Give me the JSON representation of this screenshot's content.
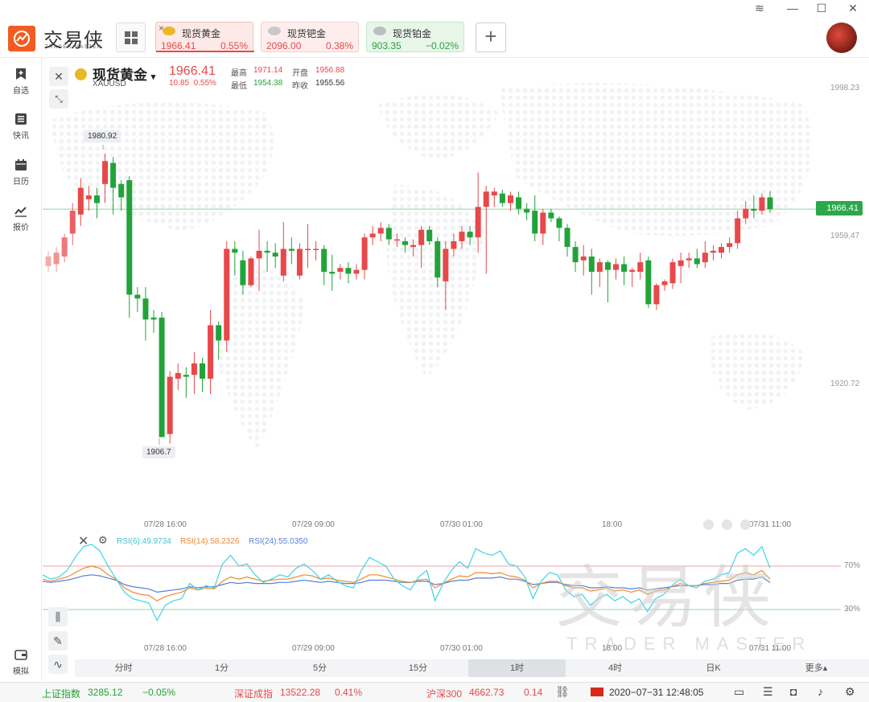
{
  "app": {
    "logo_text": "交易侠",
    "logo_sub": "TRADER MASTER",
    "window_controls": [
      "≋",
      "—",
      "☐",
      "✕"
    ]
  },
  "quote_tabs": [
    {
      "name": "现货黄金",
      "price": "1966.41",
      "change": "0.55%",
      "direction": "up",
      "close_icon": "×"
    },
    {
      "name": "现货钯金",
      "price": "2096.00",
      "change": "0.38%",
      "direction": "up"
    },
    {
      "name": "现货铂金",
      "price": "903.35",
      "change": "−0.02%",
      "direction": "down"
    }
  ],
  "add_tab_label": "+",
  "sidebar": [
    {
      "label": "自选",
      "icon": "bookmark-plus-icon"
    },
    {
      "label": "快讯",
      "icon": "news-list-icon"
    },
    {
      "label": "日历",
      "icon": "calendar-icon"
    },
    {
      "label": "报价",
      "icon": "trend-line-icon"
    },
    {
      "label": "模拟",
      "icon": "wallet-icon"
    }
  ],
  "instrument": {
    "name": "现货黄金",
    "dropdown": "▾",
    "code": "XAUUSD",
    "price": "1966.41",
    "change": "10.85",
    "change_pct": "0.55%",
    "stats": {
      "high_label": "最高",
      "high": "1971.14",
      "open_label": "开盘",
      "open": "1956.88",
      "low_label": "最低",
      "low": "1954.38",
      "prev_label": "昨收",
      "prev": "1955.56"
    }
  },
  "chart_data": {
    "type": "candlestick",
    "y_axis_labels": [
      "1998.23",
      "1959.47",
      "1920.72"
    ],
    "current_price_label": "1966.41",
    "high_marker": "1980.92",
    "low_marker": "1906.7",
    "x_axis_labels": [
      "07/28 16:00",
      "07/29 09:00",
      "07/30 01:00",
      "18:00",
      "07/31 11:00"
    ],
    "ylim": [
      1900,
      2003
    ],
    "candles": [
      [
        1951.5,
        1954.0,
        1949.8,
        1955.5
      ],
      [
        1952.0,
        1955.0,
        1950.0,
        1956.5
      ],
      [
        1954.0,
        1959.0,
        1952.5,
        1960.0
      ],
      [
        1960.0,
        1966.0,
        1957.0,
        1968.0
      ],
      [
        1965.0,
        1972.0,
        1962.0,
        1974.5
      ],
      [
        1969.0,
        1970.0,
        1966.0,
        1972.5
      ],
      [
        1970.0,
        1968.0,
        1964.0,
        1972.0
      ],
      [
        1973.0,
        1979.0,
        1968.0,
        1980.9
      ],
      [
        1978.5,
        1972.0,
        1965.0,
        1980.0
      ],
      [
        1973.0,
        1969.5,
        1966.0,
        1974.0
      ],
      [
        1974.0,
        1944.0,
        1938.0,
        1975.0
      ],
      [
        1944.0,
        1943.0,
        1939.5,
        1946.0
      ],
      [
        1943.0,
        1937.5,
        1932.0,
        1946.0
      ],
      [
        1938.0,
        1937.5,
        1934.0,
        1940.0
      ],
      [
        1938.0,
        1906.7,
        1906.7,
        1939.5
      ],
      [
        1907.5,
        1922.5,
        1905.0,
        1924.0
      ],
      [
        1922.0,
        1923.5,
        1919.0,
        1926.0
      ],
      [
        1923.0,
        1922.5,
        1917.0,
        1925.0
      ],
      [
        1923.0,
        1926.0,
        1918.0,
        1929.0
      ],
      [
        1926.0,
        1922.0,
        1918.5,
        1927.5
      ],
      [
        1922.0,
        1936.0,
        1918.0,
        1940.0
      ],
      [
        1936.0,
        1932.0,
        1927.0,
        1937.0
      ],
      [
        1932.0,
        1956.0,
        1929.0,
        1958.0
      ],
      [
        1956.0,
        1955.0,
        1949.0,
        1958.0
      ],
      [
        1953.0,
        1946.5,
        1944.0,
        1955.5
      ],
      [
        1946.5,
        1953.5,
        1946.0,
        1954.0
      ],
      [
        1953.5,
        1955.5,
        1945.0,
        1961.0
      ],
      [
        1955.5,
        1955.0,
        1950.0,
        1958.0
      ],
      [
        1955.0,
        1954.0,
        1951.0,
        1957.5
      ],
      [
        1949.0,
        1956.0,
        1947.5,
        1963.0
      ],
      [
        1956.0,
        1955.5,
        1952.0,
        1959.0
      ],
      [
        1949.0,
        1956.0,
        1948.0,
        1957.5
      ],
      [
        1956.0,
        1956.0,
        1951.0,
        1962.5
      ],
      [
        1956.0,
        1956.0,
        1953.0,
        1958.0
      ],
      [
        1956.0,
        1950.0,
        1946.5,
        1957.0
      ],
      [
        1950.0,
        1949.5,
        1945.0,
        1954.5
      ],
      [
        1950.0,
        1951.0,
        1948.0,
        1952.0
      ],
      [
        1951.0,
        1949.5,
        1947.0,
        1952.5
      ],
      [
        1949.5,
        1950.5,
        1948.0,
        1952.0
      ],
      [
        1950.5,
        1959.0,
        1948.0,
        1960.0
      ],
      [
        1959.0,
        1960.0,
        1957.0,
        1962.0
      ],
      [
        1960.0,
        1961.5,
        1958.0,
        1963.0
      ],
      [
        1961.5,
        1958.5,
        1957.0,
        1962.5
      ],
      [
        1958.5,
        1958.5,
        1956.5,
        1960.0
      ],
      [
        1958.0,
        1957.0,
        1955.0,
        1959.0
      ],
      [
        1956.5,
        1957.0,
        1954.0,
        1958.5
      ],
      [
        1957.0,
        1961.0,
        1951.0,
        1962.0
      ],
      [
        1961.0,
        1958.0,
        1957.0,
        1962.0
      ],
      [
        1958.0,
        1948.5,
        1946.0,
        1959.0
      ],
      [
        1947.5,
        1956.0,
        1940.0,
        1958.0
      ],
      [
        1956.0,
        1958.0,
        1954.0,
        1960.0
      ],
      [
        1958.0,
        1960.5,
        1956.0,
        1962.0
      ],
      [
        1960.5,
        1959.0,
        1957.0,
        1962.0
      ],
      [
        1959.0,
        1967.0,
        1955.0,
        1976.0
      ],
      [
        1967.0,
        1971.0,
        1949.5,
        1972.5
      ],
      [
        1970.0,
        1971.0,
        1967.0,
        1972.0
      ],
      [
        1970.5,
        1968.0,
        1967.0,
        1971.5
      ],
      [
        1968.0,
        1970.0,
        1966.0,
        1971.0
      ],
      [
        1969.5,
        1966.5,
        1965.0,
        1971.0
      ],
      [
        1966.5,
        1965.5,
        1963.5,
        1968.0
      ],
      [
        1966.0,
        1960.0,
        1958.0,
        1970.0
      ],
      [
        1960.0,
        1965.5,
        1957.0,
        1966.5
      ],
      [
        1965.5,
        1964.0,
        1963.0,
        1966.5
      ],
      [
        1964.0,
        1961.5,
        1958.0,
        1964.5
      ],
      [
        1961.5,
        1956.5,
        1954.0,
        1962.5
      ],
      [
        1956.5,
        1952.5,
        1950.0,
        1958.0
      ],
      [
        1953.0,
        1954.0,
        1949.0,
        1957.0
      ],
      [
        1954.0,
        1950.0,
        1944.0,
        1956.0
      ],
      [
        1950.0,
        1952.5,
        1946.0,
        1953.5
      ],
      [
        1952.5,
        1950.5,
        1942.0,
        1953.0
      ],
      [
        1950.5,
        1952.0,
        1948.0,
        1953.5
      ],
      [
        1952.0,
        1950.0,
        1946.5,
        1954.0
      ],
      [
        1950.0,
        1950.5,
        1946.0,
        1951.0
      ],
      [
        1950.0,
        1952.5,
        1948.0,
        1955.0
      ],
      [
        1953.0,
        1941.5,
        1940.5,
        1954.0
      ],
      [
        1941.5,
        1946.5,
        1940.0,
        1947.0
      ],
      [
        1946.5,
        1947.5,
        1945.0,
        1948.0
      ],
      [
        1947.0,
        1952.5,
        1945.5,
        1953.5
      ],
      [
        1951.5,
        1953.0,
        1947.0,
        1955.0
      ],
      [
        1953.0,
        1953.5,
        1951.0,
        1955.0
      ],
      [
        1953.5,
        1952.0,
        1951.0,
        1956.0
      ],
      [
        1952.5,
        1955.0,
        1951.0,
        1958.0
      ],
      [
        1955.0,
        1955.5,
        1953.0,
        1957.0
      ],
      [
        1955.0,
        1956.5,
        1953.5,
        1957.5
      ],
      [
        1956.5,
        1957.5,
        1955.0,
        1959.0
      ],
      [
        1957.5,
        1964.0,
        1956.0,
        1966.0
      ],
      [
        1964.0,
        1966.5,
        1962.5,
        1968.5
      ],
      [
        1966.5,
        1966.0,
        1964.0,
        1970.0
      ],
      [
        1966.0,
        1969.5,
        1965.0,
        1970.5
      ],
      [
        1969.5,
        1966.4,
        1965.5,
        1971.1
      ]
    ]
  },
  "rsi": {
    "labels": {
      "rsi6": "RSI(6):49.9734",
      "rsi14": "RSI(14):58.2326",
      "rsi24": "RSI(24):55.0350"
    },
    "levels": [
      "70%",
      "30%"
    ],
    "x_axis_labels": [
      "07/28 16:00",
      "07/29 09:00",
      "07/30 01:00",
      "18:00",
      "07/31 11:00"
    ],
    "rsi6": [
      62,
      58,
      60,
      66,
      78,
      88,
      90,
      84,
      70,
      58,
      46,
      40,
      38,
      36,
      20,
      34,
      38,
      40,
      54,
      48,
      52,
      50,
      72,
      80,
      70,
      72,
      62,
      55,
      58,
      62,
      60,
      68,
      72,
      66,
      58,
      62,
      56,
      52,
      50,
      66,
      78,
      74,
      70,
      58,
      52,
      48,
      60,
      66,
      38,
      54,
      66,
      74,
      68,
      86,
      82,
      80,
      84,
      72,
      70,
      60,
      40,
      56,
      64,
      62,
      48,
      42,
      44,
      34,
      40,
      44,
      38,
      42,
      36,
      40,
      28,
      40,
      44,
      52,
      58,
      52,
      50,
      56,
      58,
      62,
      64,
      82,
      86,
      80,
      88,
      68
    ],
    "rsi14": [
      58,
      56,
      58,
      60,
      64,
      68,
      70,
      68,
      62,
      58,
      50,
      46,
      44,
      43,
      38,
      42,
      44,
      46,
      50,
      48,
      50,
      49,
      56,
      60,
      58,
      60,
      58,
      56,
      57,
      58,
      58,
      60,
      62,
      61,
      58,
      59,
      57,
      56,
      55,
      58,
      62,
      62,
      60,
      58,
      56,
      55,
      57,
      58,
      50,
      54,
      58,
      61,
      60,
      64,
      64,
      63,
      64,
      61,
      60,
      57,
      50,
      54,
      56,
      56,
      52,
      50,
      50,
      47,
      48,
      50,
      47,
      48,
      46,
      48,
      44,
      47,
      48,
      51,
      54,
      52,
      52,
      54,
      55,
      56,
      57,
      62,
      64,
      62,
      66,
      58
    ],
    "rsi24": [
      56,
      55,
      56,
      57,
      59,
      61,
      62,
      61,
      59,
      57,
      53,
      51,
      50,
      49,
      46,
      47,
      48,
      49,
      51,
      50,
      51,
      51,
      53,
      55,
      54,
      55,
      54,
      54,
      54,
      55,
      55,
      56,
      57,
      56,
      55,
      56,
      55,
      54,
      54,
      55,
      57,
      57,
      57,
      56,
      55,
      55,
      56,
      56,
      53,
      54,
      56,
      57,
      57,
      59,
      59,
      59,
      60,
      58,
      58,
      56,
      53,
      54,
      55,
      55,
      53,
      52,
      52,
      50,
      50,
      51,
      50,
      50,
      49,
      50,
      48,
      49,
      50,
      51,
      52,
      52,
      52,
      53,
      53,
      54,
      54,
      57,
      58,
      58,
      60,
      55
    ]
  },
  "periods": [
    "分时",
    "1分",
    "5分",
    "15分",
    "1时",
    "4时",
    "日K",
    "更多▴"
  ],
  "active_period": "1时",
  "watermark": {
    "text": "交易侠",
    "sub": "TRADER MASTER"
  },
  "statusbar": {
    "items": [
      {
        "name": "上证指数",
        "value": "3285.12",
        "change": "−0.05%",
        "dir": "down"
      },
      {
        "name": "深证成指",
        "value": "13522.28",
        "change": "0.41%",
        "dir": "up"
      },
      {
        "name": "沪深300",
        "value": "4662.73",
        "change": "0.14",
        "dir": "up"
      }
    ],
    "datetime": "2020−07−31 12:48:05"
  },
  "colors": {
    "up": "#e8484a",
    "down": "#22a33a",
    "rsi6": "#3fd3e6",
    "rsi14": "#f08a2c",
    "rsi24": "#5a7fd6",
    "accent": "#f25c22"
  }
}
